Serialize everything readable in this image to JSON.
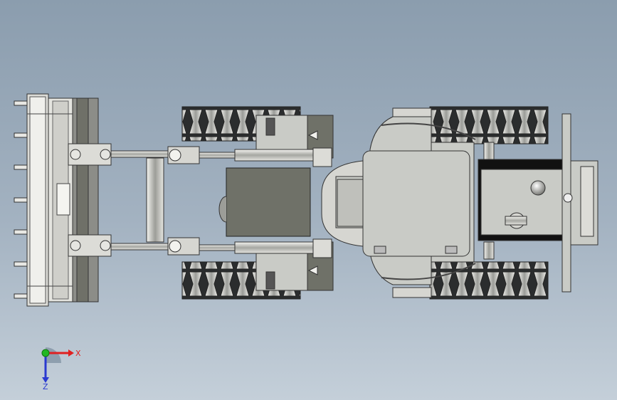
{
  "viewport": {
    "model": "wheel-loader",
    "view": "top",
    "background_colors": [
      "#8b9dae",
      "#c4cfd9"
    ],
    "body_color": "#c9cbc6",
    "shadow_color": "#6f7168",
    "tire_color": "#2b2d2e"
  },
  "triad": {
    "x_label": "X",
    "z_label": "Z",
    "x_color": "#e02020",
    "y_color": "#22b822",
    "z_color": "#2a3ad0"
  }
}
